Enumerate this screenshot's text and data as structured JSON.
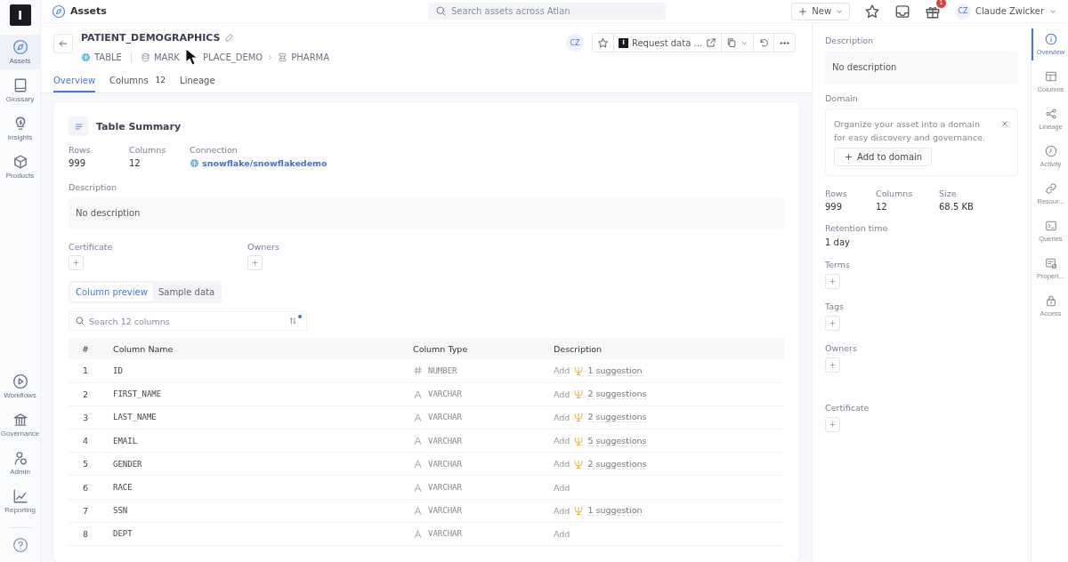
{
  "rail": {
    "logo": "I",
    "top_items": [
      {
        "label": "Assets",
        "selected": true
      },
      {
        "label": "Glossary",
        "selected": false
      },
      {
        "label": "Insights",
        "selected": false
      },
      {
        "label": "Products",
        "selected": false
      }
    ],
    "bottom_items": [
      {
        "label": "Workflows",
        "selected": false
      },
      {
        "label": "Governance",
        "selected": false
      },
      {
        "label": "Admin",
        "selected": false
      },
      {
        "label": "Reporting",
        "selected": false
      }
    ]
  },
  "topbar": {
    "title": "Assets",
    "search": {
      "placeholder": "Search assets across Atlan"
    },
    "new_button": "New",
    "gift_badge": "1",
    "user": {
      "initials": "CZ",
      "name": "Claude Zwicker"
    }
  },
  "header": {
    "title": "PATIENT_DEMOGRAPHICS",
    "type": "TABLE",
    "database_fragments": [
      "MARK",
      "PLACE_DEMO"
    ],
    "schema": "PHARMA",
    "avatar": "CZ",
    "request_button": "Request data ...",
    "logo_letter": "I"
  },
  "tabs": [
    {
      "label": "Overview",
      "selected": true
    },
    {
      "label": "Columns",
      "count": "12",
      "selected": false
    },
    {
      "label": "Lineage",
      "selected": false
    }
  ],
  "summary": {
    "title": "Table Summary",
    "stats": [
      {
        "label": "Rows",
        "value": "999"
      },
      {
        "label": "Columns",
        "value": "12"
      }
    ],
    "connection": {
      "label": "Connection",
      "value": "snowflake/snowflakedemo"
    },
    "description": {
      "label": "Description",
      "value": "No description"
    },
    "certificate": "Certificate",
    "owners": "Owners",
    "toggle": [
      {
        "label": "Column preview",
        "selected": true
      },
      {
        "label": "Sample data",
        "selected": false
      }
    ],
    "column_search": {
      "placeholder": "Search 12 columns"
    }
  },
  "table": {
    "columns": [
      "#",
      "Column Name",
      "Column Type",
      "Description"
    ],
    "rows": [
      {
        "num": "1",
        "name": "ID",
        "kind": "number",
        "type": "NUMBER",
        "add": "Add",
        "suggestion": "1 suggestion"
      },
      {
        "num": "2",
        "name": "FIRST_NAME",
        "kind": "varchar",
        "type": "VARCHAR",
        "add": "Add",
        "suggestion": "2 suggestions"
      },
      {
        "num": "3",
        "name": "LAST_NAME",
        "kind": "varchar",
        "type": "VARCHAR",
        "add": "Add",
        "suggestion": "2 suggestions"
      },
      {
        "num": "4",
        "name": "EMAIL",
        "kind": "varchar",
        "type": "VARCHAR",
        "add": "Add",
        "suggestion": "5 suggestions"
      },
      {
        "num": "5",
        "name": "GENDER",
        "kind": "varchar",
        "type": "VARCHAR",
        "add": "Add",
        "suggestion": "2 suggestions"
      },
      {
        "num": "6",
        "name": "RACE",
        "kind": "varchar",
        "type": "VARCHAR",
        "add": "Add",
        "suggestion": null
      },
      {
        "num": "7",
        "name": "SSN",
        "kind": "varchar",
        "type": "VARCHAR",
        "add": "Add",
        "suggestion": "1 suggestion"
      },
      {
        "num": "8",
        "name": "DEPT",
        "kind": "varchar",
        "type": "VARCHAR",
        "add": "Add",
        "suggestion": null
      }
    ]
  },
  "side": {
    "description": {
      "label": "Description",
      "value": "No description"
    },
    "domain": {
      "label": "Domain",
      "text": "Organize your asset into a domain for easy discovery and governance.",
      "button": "Add to domain"
    },
    "stats": [
      {
        "label": "Rows",
        "value": "999"
      },
      {
        "label": "Columns",
        "value": "12"
      },
      {
        "label": "Size",
        "value": "68.5 KB"
      }
    ],
    "retention": {
      "label": "Retention time",
      "value": "1 day"
    },
    "add_sections": [
      "Terms",
      "Tags",
      "Owners",
      "Certificate"
    ]
  },
  "side_rail": [
    {
      "label": "Overview",
      "selected": true
    },
    {
      "label": "Columns",
      "selected": false
    },
    {
      "label": "Lineage",
      "selected": false
    },
    {
      "label": "Activity",
      "selected": false
    },
    {
      "label": "Resour...",
      "selected": false
    },
    {
      "label": "Queries",
      "selected": false
    },
    {
      "label": "Propert...",
      "selected": false
    },
    {
      "label": "Access",
      "selected": false
    }
  ]
}
